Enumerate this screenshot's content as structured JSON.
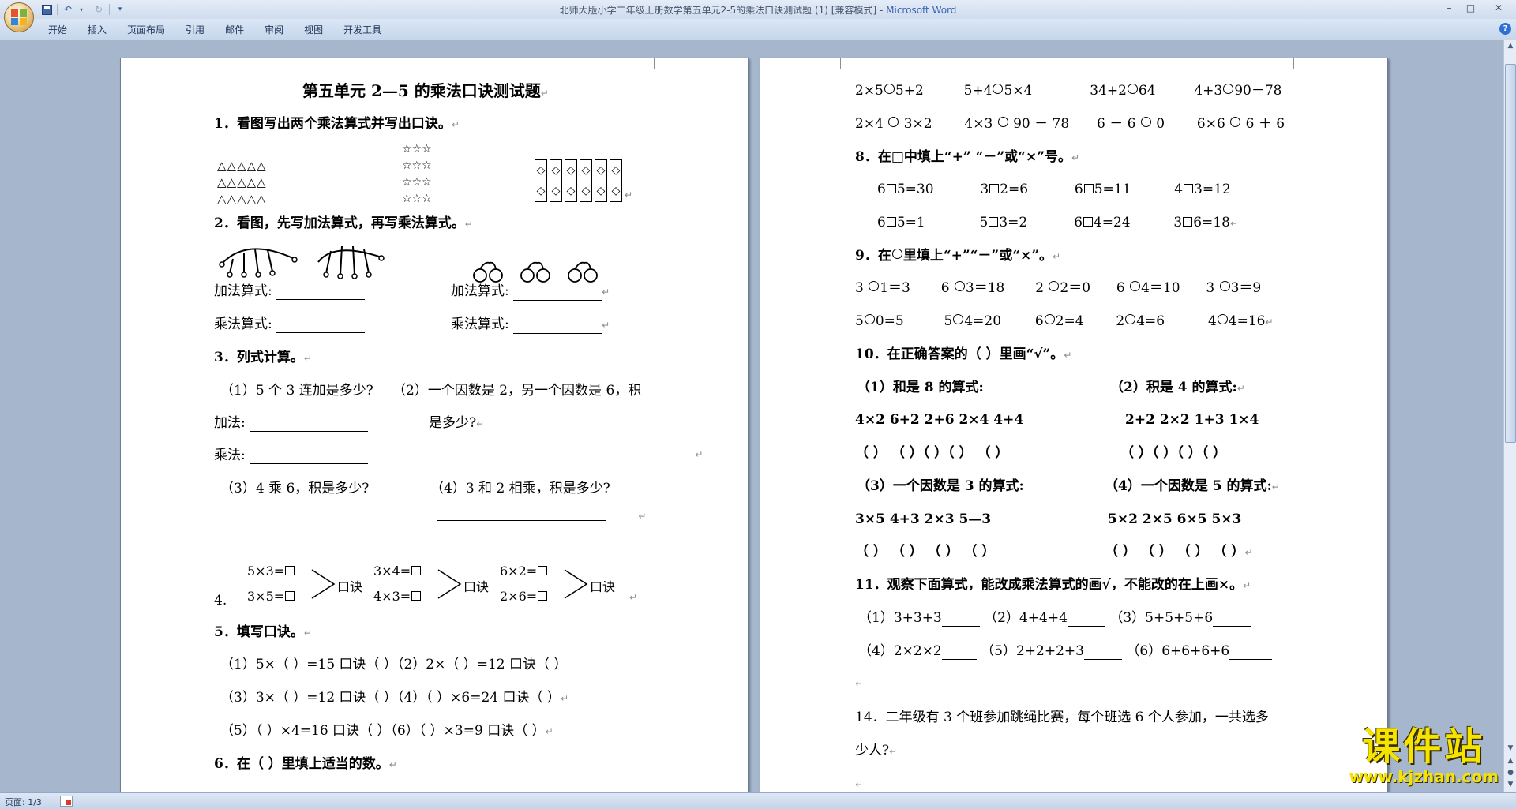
{
  "titlebar": {
    "doc_name": "北师大版小学二年级上册数学第五单元2-5的乘法口诀测试题 (1) [兼容模式] - ",
    "app_name": "Microsoft Word",
    "qat_customize": "▾",
    "minimize": "–",
    "maximize": "□",
    "close": "✕"
  },
  "ribbon": {
    "tabs": [
      "开始",
      "插入",
      "页面布局",
      "引用",
      "邮件",
      "审阅",
      "视图",
      "开发工具"
    ],
    "help": "?"
  },
  "page1": {
    "title": "第五单元 2—5 的乘法口诀测试题",
    "q1": "1．看图写出两个乘法算式并写出口诀。",
    "q1_triangles": [
      "△△△△△",
      "△△△△△",
      "△△△△△"
    ],
    "q1_stars": [
      "☆☆☆",
      "☆☆☆",
      "☆☆☆",
      "☆☆☆"
    ],
    "q1_diamond": "◇",
    "q2": "2．看图，先写加法算式，再写乘法算式。",
    "q2_add": "加法算式:",
    "q2_mul": "乘法算式:",
    "q3": "3．列式计算。",
    "q3_a": "（1）5 个 3 连加是多少?",
    "q3_b1": "（2）一个因数是 2，另一个因数是 6，积",
    "q3_b2": "是多少?",
    "q3_add": "加法:",
    "q3_mul": "乘法:",
    "q3_c": "（3）4  乘  6，积是多少?",
    "q3_d": "（4）3  和  2  相乘，积是多少?",
    "q4_num": "4.",
    "q4_groups": [
      {
        "a": "5×3=",
        "b": "3×5="
      },
      {
        "a": "3×4=",
        "b": "4×3="
      },
      {
        "a": "6×2=",
        "b": "2×6="
      }
    ],
    "q4_kj": "口诀",
    "q5": "5．填写口诀。",
    "q5_lines": [
      "（1）5×（ ）=15 口诀（        ）（2）2×（  ）=12 口诀（   ）",
      "（3）3×（ ）=12 口诀（        ）（4）（ ）×6=24 口诀（   ）",
      "（5）（ ）×4=16 口诀（        ）（6）（ ）×3=9 口诀（   ）"
    ],
    "q6": "6．在（    ）里填上适当的数。"
  },
  "page2": {
    "r1": [
      "2×5",
      "5+2",
      "5+4",
      "5×4",
      "34+2",
      "64",
      "4+3",
      "90－78"
    ],
    "r2": [
      "2×4",
      "3×2",
      "4×3",
      "90 － 78",
      "6 － 6",
      "0",
      "6×6",
      "6 ＋ 6"
    ],
    "q8": "8．在□中填上“+” “－”或“×”号。",
    "q8_r1": [
      [
        "6",
        "5=30"
      ],
      [
        "3",
        "2=6"
      ],
      [
        "6",
        "5=11"
      ],
      [
        "4",
        "3=12"
      ]
    ],
    "q8_r2": [
      [
        "6",
        "5=1"
      ],
      [
        "5",
        "3=2"
      ],
      [
        "6",
        "4=24"
      ],
      [
        "3",
        "6=18"
      ]
    ],
    "q9": "9．在",
    "q9_b": "里填上“+”“－”或“×”。",
    "q9_r1": [
      [
        "3",
        "1＝3"
      ],
      [
        "6",
        "3＝18"
      ],
      [
        "2",
        "2＝0"
      ],
      [
        "6",
        "4＝10"
      ],
      [
        "3",
        "3＝9"
      ]
    ],
    "q9_r2": [
      [
        "5",
        "0=5"
      ],
      [
        "5",
        "4=20"
      ],
      [
        "6",
        "2=4"
      ],
      [
        "2",
        "4=6"
      ],
      [
        "4",
        "4=16"
      ]
    ],
    "q10": "10．在正确答案的（     ）里画“√”。",
    "q10_1": "（1）和是 8 的算式:",
    "q10_2": "（2）积是 4 的算式:",
    "q10_r1": "4×2   6+2   2+6   2×4   4+4",
    "q10_r1b": "2+2   2×2   1+3   1×4",
    "q10_p1": "（  ）   （  ）（  ）（  ）   （  ）",
    "q10_p1b": "（    ）（    ）（    ）（  ）",
    "q10_3": "（3）一个因数是 3 的算式:",
    "q10_4": "（4）一个因数是 5 的算式:",
    "q10_r2": "3×5    4+3    2×3    5—3",
    "q10_r2b": "5×2    2×5    6×5    5×3",
    "q10_p2": "（  ）   （  ）   （  ）   （  ）",
    "q10_p2b": "（  ）    （  ）   （  ）   （  ）",
    "q11": "11．观察下面算式，能改成乘法算式的画√，不能改的在上画×。",
    "q11_r1": [
      "（1）3+3+3",
      "（2）4+4+4",
      "（3）5+5+5+6"
    ],
    "q11_r2": [
      "（4）2×2×2",
      "（5）2+2+2+3",
      "（6）6+6+6+6"
    ],
    "q14a": "14．二年级有 3 个班参加跳绳比赛，每个班选 6 个人参加，一共选多",
    "q14b": "少人?"
  },
  "para_mark": "↵",
  "status": {
    "page": "页面: 1/3"
  },
  "watermark": {
    "cn": "课件站",
    "url": "www.kjzhan.com"
  }
}
